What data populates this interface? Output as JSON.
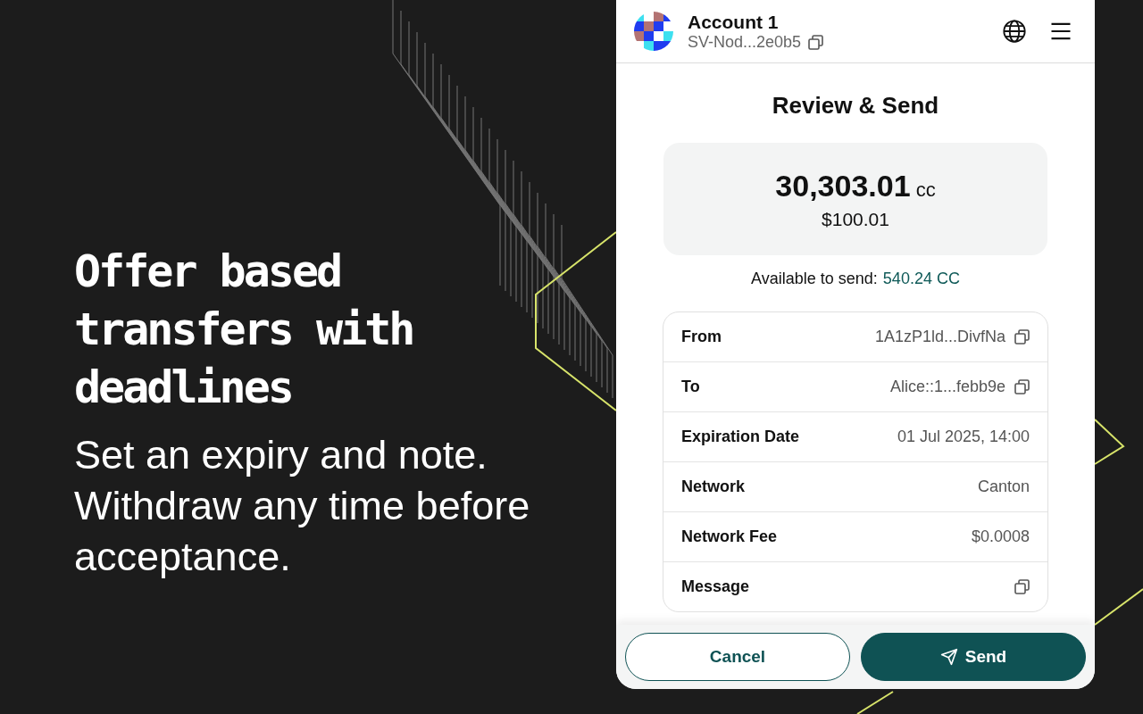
{
  "promo": {
    "headline": "Offer based transfers with deadlines",
    "subtext": "Set an expiry and note. Withdraw any time before acceptance."
  },
  "header": {
    "account_name": "Account 1",
    "address": "SV-Nod...2e0b5"
  },
  "title": "Review & Send",
  "amount": {
    "value": "30,303.01",
    "unit": "cc",
    "fiat": "$100.01"
  },
  "available": {
    "label": "Available to send:",
    "value": "540.24 CC"
  },
  "details": [
    {
      "label": "From",
      "value": "1A1zP1ld...DivfNa",
      "kind": "copyable"
    },
    {
      "label": "To",
      "value": "Alice::1...febb9e",
      "kind": "copyable"
    },
    {
      "label": "Expiration Date",
      "value": "01 Jul 2025, 14:00",
      "kind": "plain"
    },
    {
      "label": "Network",
      "value": "Canton",
      "kind": "plain"
    },
    {
      "label": "Network Fee",
      "value": "$0.0008",
      "kind": "plain"
    },
    {
      "label": "Message",
      "kind": "copyable"
    }
  ],
  "buttons": [
    {
      "label": "Cancel",
      "kind": "secondary"
    },
    {
      "label": "Send",
      "kind": "primary"
    }
  ]
}
